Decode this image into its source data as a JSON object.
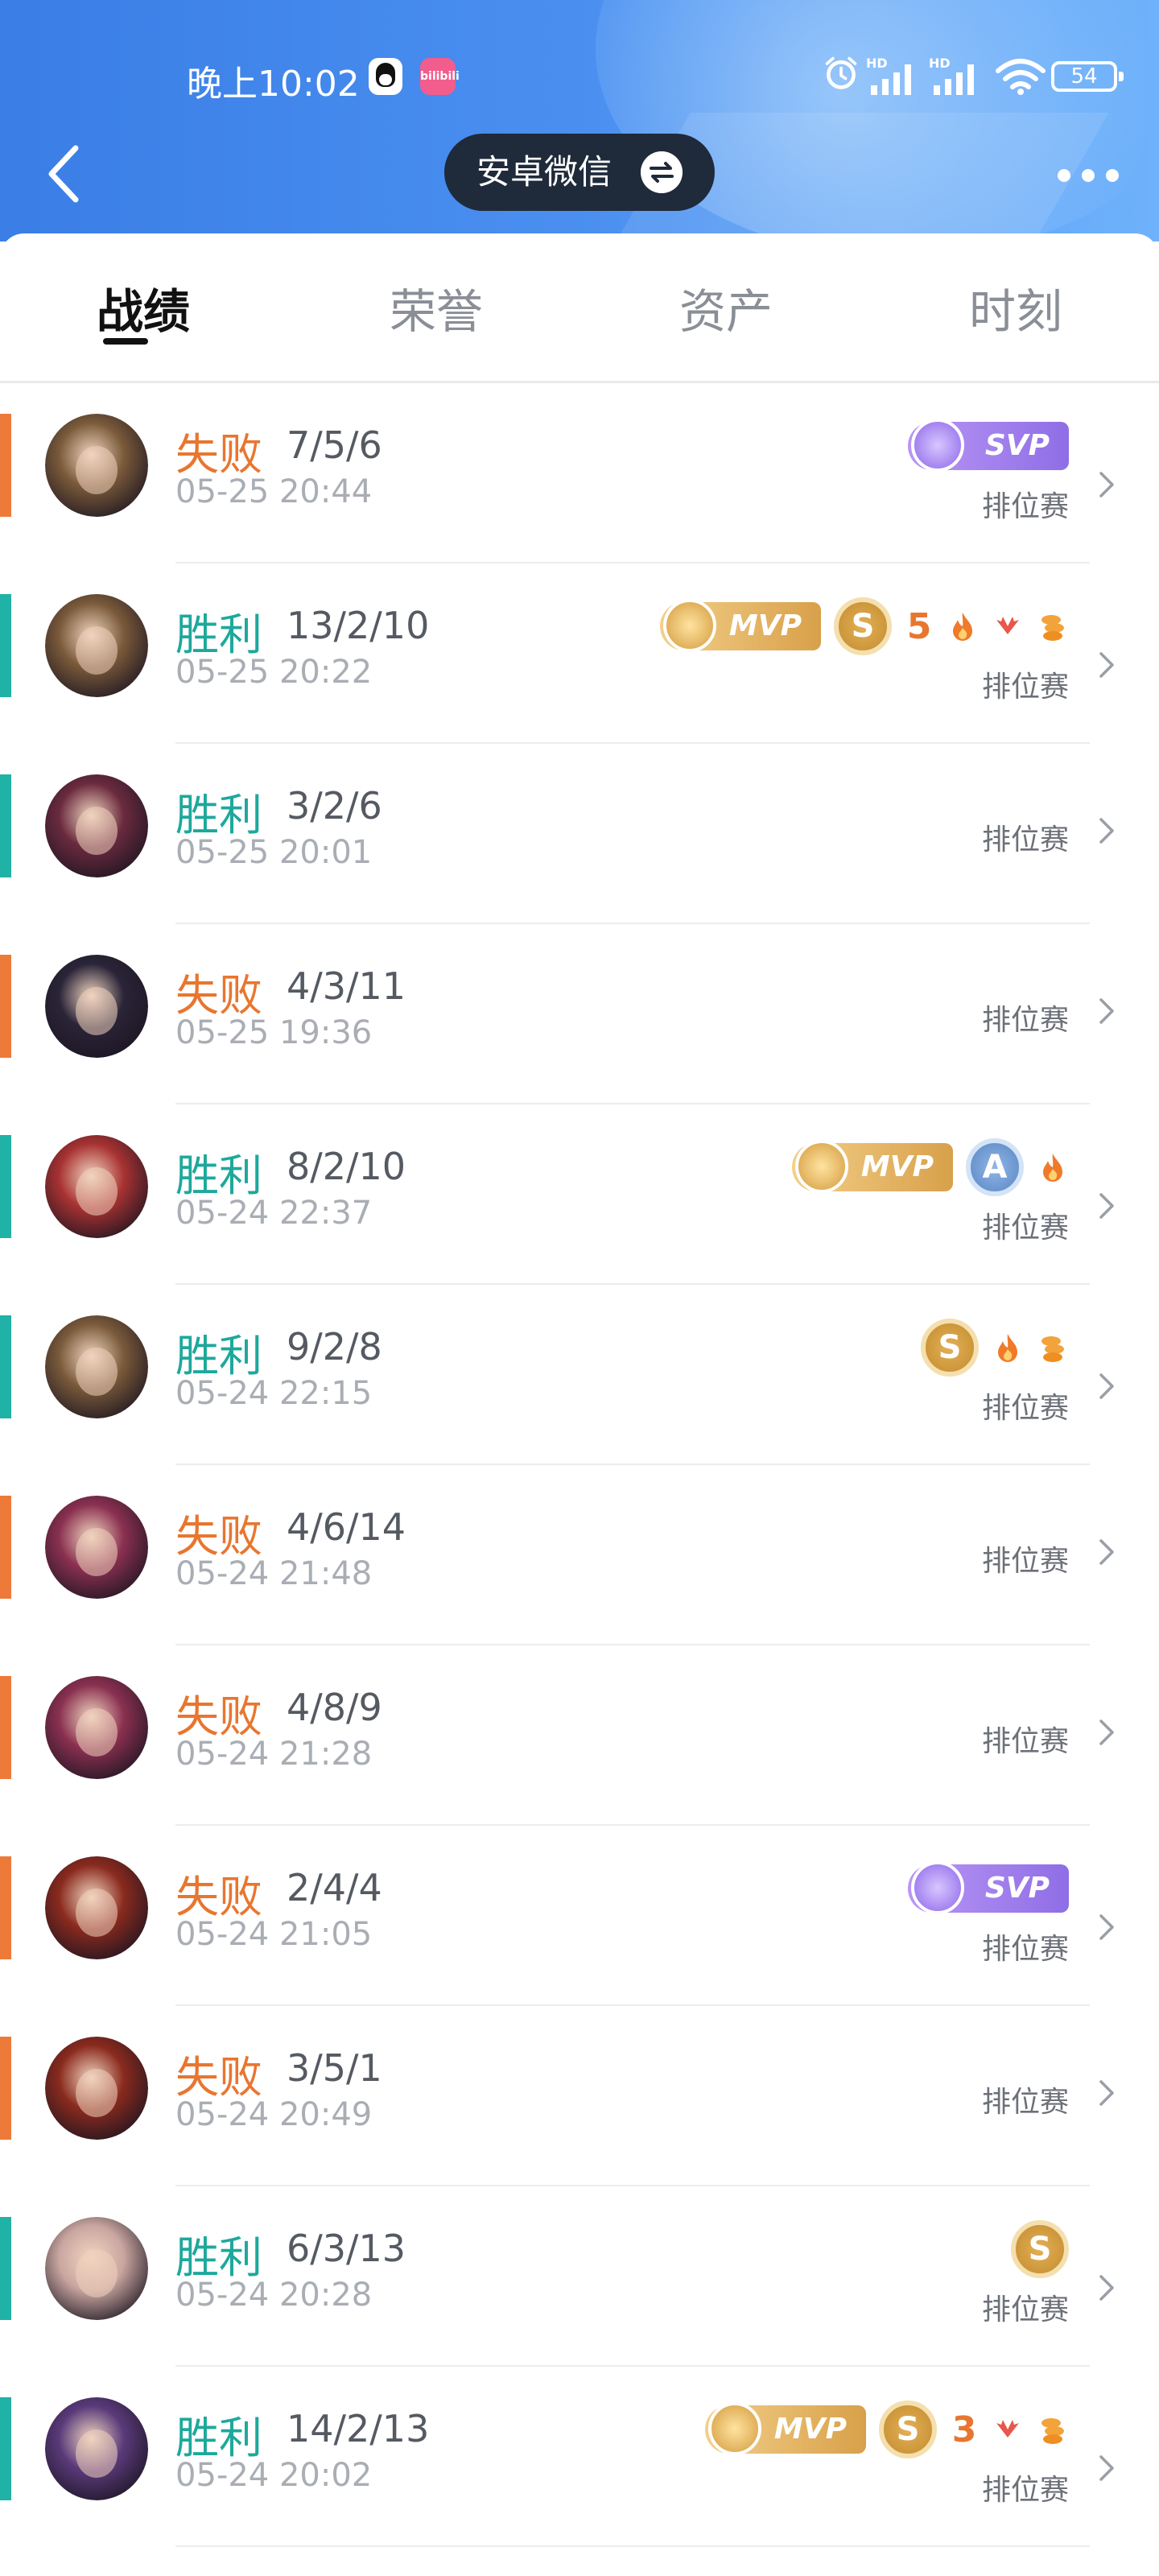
{
  "status_bar": {
    "time": "晚上10:02",
    "battery": "54",
    "app_icons": [
      "qq-icon",
      "bilibili-icon"
    ],
    "bili_text": "bilibili"
  },
  "nav": {
    "title": "安卓微信"
  },
  "tabs": [
    {
      "label": "战绩",
      "active": true
    },
    {
      "label": "荣誉",
      "active": false
    },
    {
      "label": "资产",
      "active": false
    },
    {
      "label": "时刻",
      "active": false
    }
  ],
  "colors": {
    "win": "#1ea89c",
    "lose": "#e8762f",
    "header_start": "#3a7ee6",
    "header_end": "#6fb2fb"
  },
  "matches": [
    {
      "result": "失败",
      "outcome": "lose",
      "kda": "7/5/6",
      "time": "05-25 20:44",
      "mode": "排位赛",
      "hero_color": "#7a5a3a",
      "badges": [
        {
          "type": "svp",
          "text": "SVP"
        }
      ]
    },
    {
      "result": "胜利",
      "outcome": "win",
      "kda": "13/2/10",
      "time": "05-25 20:22",
      "mode": "排位赛",
      "hero_color": "#7a5a3a",
      "badges": [
        {
          "type": "mvp",
          "text": "MVP"
        },
        {
          "type": "grade-s",
          "text": "S"
        },
        {
          "type": "streak",
          "text": "5"
        },
        {
          "type": "flame"
        },
        {
          "type": "wings"
        },
        {
          "type": "coins"
        }
      ]
    },
    {
      "result": "胜利",
      "outcome": "win",
      "kda": "3/2/6",
      "time": "05-25 20:01",
      "mode": "排位赛",
      "hero_color": "#6a2a3e",
      "badges": []
    },
    {
      "result": "失败",
      "outcome": "lose",
      "kda": "4/3/11",
      "time": "05-25 19:36",
      "mode": "排位赛",
      "hero_color": "#2a2438",
      "badges": []
    },
    {
      "result": "胜利",
      "outcome": "win",
      "kda": "8/2/10",
      "time": "05-24 22:37",
      "mode": "排位赛",
      "hero_color": "#a83232",
      "badges": [
        {
          "type": "mvp",
          "text": "MVP"
        },
        {
          "type": "grade-a",
          "text": "A"
        },
        {
          "type": "flame"
        }
      ]
    },
    {
      "result": "胜利",
      "outcome": "win",
      "kda": "9/2/8",
      "time": "05-24 22:15",
      "mode": "排位赛",
      "hero_color": "#7a5a3a",
      "badges": [
        {
          "type": "grade-s",
          "text": "S"
        },
        {
          "type": "flame"
        },
        {
          "type": "coins"
        }
      ]
    },
    {
      "result": "失败",
      "outcome": "lose",
      "kda": "4/6/14",
      "time": "05-24 21:48",
      "mode": "排位赛",
      "hero_color": "#8a3050",
      "badges": []
    },
    {
      "result": "失败",
      "outcome": "lose",
      "kda": "4/8/9",
      "time": "05-24 21:28",
      "mode": "排位赛",
      "hero_color": "#8a3050",
      "badges": []
    },
    {
      "result": "失败",
      "outcome": "lose",
      "kda": "2/4/4",
      "time": "05-24 21:05",
      "mode": "排位赛",
      "hero_color": "#8a2a1e",
      "badges": [
        {
          "type": "svp",
          "text": "SVP"
        }
      ]
    },
    {
      "result": "失败",
      "outcome": "lose",
      "kda": "3/5/1",
      "time": "05-24 20:49",
      "mode": "排位赛",
      "hero_color": "#8a2a1e",
      "badges": []
    },
    {
      "result": "胜利",
      "outcome": "win",
      "kda": "6/3/13",
      "time": "05-24 20:28",
      "mode": "排位赛",
      "hero_color": "#c9a6a0",
      "badges": [
        {
          "type": "grade-s",
          "text": "S"
        }
      ]
    },
    {
      "result": "胜利",
      "outcome": "win",
      "kda": "14/2/13",
      "time": "05-24 20:02",
      "mode": "排位赛",
      "hero_color": "#5a3a7a",
      "badges": [
        {
          "type": "mvp",
          "text": "MVP"
        },
        {
          "type": "grade-s",
          "text": "S"
        },
        {
          "type": "streak",
          "text": "3"
        },
        {
          "type": "wings"
        },
        {
          "type": "coins"
        }
      ]
    }
  ]
}
